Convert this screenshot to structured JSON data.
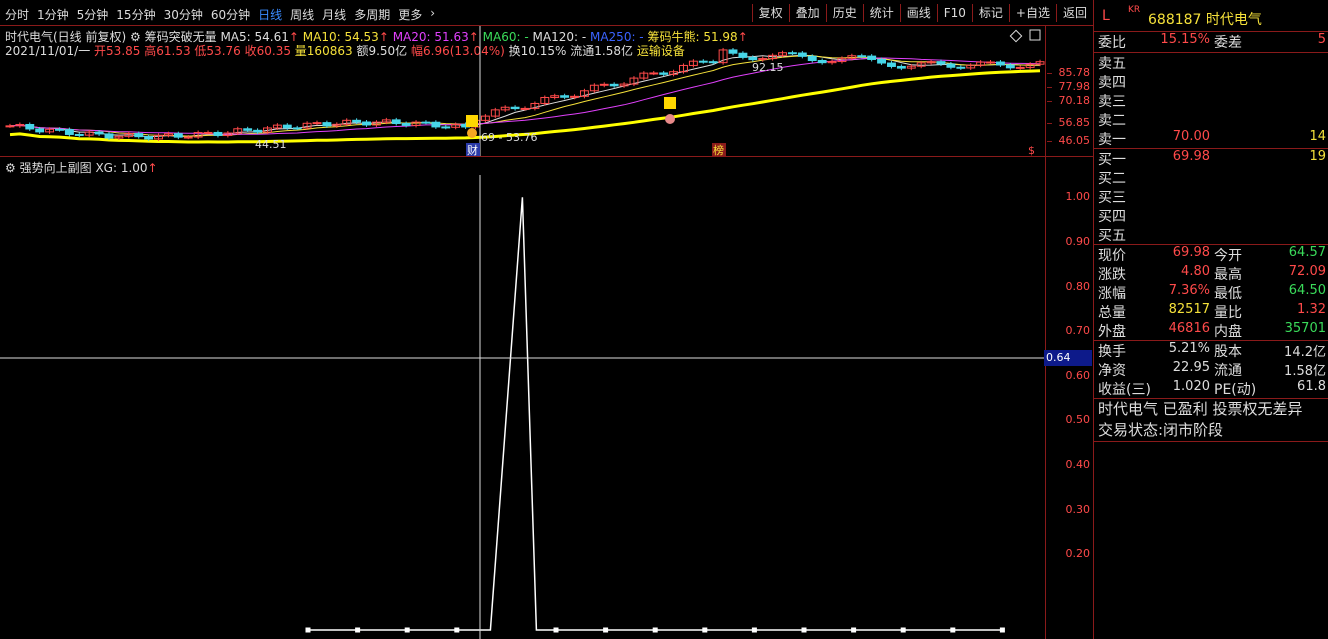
{
  "toolbar": {
    "periods": [
      "分时",
      "1分钟",
      "5分钟",
      "15分钟",
      "30分钟",
      "60分钟",
      "日线",
      "周线",
      "月线",
      "多周期",
      "更多"
    ],
    "active_period": "日线",
    "tools": [
      "复权",
      "叠加",
      "历史",
      "统计",
      "画线",
      "F10",
      "标记",
      "+自选",
      "返回"
    ]
  },
  "info": {
    "stock_title": "时代电气(日线 前复权)",
    "indicator_name": "筹码突破无量",
    "ma5": "MA5: 54.61",
    "ma10": "MA10: 54.53",
    "ma20": "MA20: 51.63",
    "ma60": "MA60: -",
    "ma120": "MA120: -",
    "ma250": "MA250: -",
    "chip_label": "筹码牛熊: 51.98",
    "date": "2021/11/01/一",
    "open": "开53.85",
    "high": "高61.53",
    "low": "低53.76",
    "close": "收60.35",
    "volume": "量160863",
    "amount": "额9.50亿",
    "change": "幅6.96(13.04%)",
    "turnover": "换10.15%",
    "float_shares": "流通1.58亿",
    "industry": "运输设备"
  },
  "main_chart": {
    "ticks": [
      "85.78",
      "77.98",
      "70.18",
      "56.85",
      "46.05"
    ],
    "low_label": "44.51",
    "high_label": "92.15",
    "range_label": "69 - 53.76",
    "marker_cai": "财",
    "marker_bang": "榜",
    "marker_s": "$"
  },
  "sub_chart": {
    "title": "强势向上副图",
    "xg": "XG: 1.00",
    "ticks": [
      "1.00",
      "0.90",
      "0.80",
      "0.70",
      "0.60",
      "0.50",
      "0.40",
      "0.30",
      "0.20"
    ],
    "cursor_value": "0.64",
    "ylim": [
      0.1,
      1.05
    ],
    "xg_values": [
      0,
      0,
      0,
      0,
      1,
      0,
      0,
      0,
      0,
      0,
      0,
      0,
      0,
      0,
      0
    ]
  },
  "chart_data": {
    "type": "line",
    "title": "强势向上副图",
    "series": [
      {
        "name": "XG",
        "values": [
          0,
          0,
          0,
          0,
          1,
          0,
          0,
          0,
          0,
          0,
          0,
          0,
          0,
          0,
          0
        ]
      }
    ],
    "ylim": [
      0.1,
      1.05
    ]
  },
  "panel": {
    "stock_L": "L",
    "stock_kr": "KR",
    "stock_code_name": "688187 时代电气",
    "weibi_label": "委比",
    "weibi": "15.15%",
    "weicha_label": "委差",
    "weicha": "5",
    "sell_levels": [
      {
        "label": "卖五",
        "price": "",
        "vol": ""
      },
      {
        "label": "卖四",
        "price": "",
        "vol": ""
      },
      {
        "label": "卖三",
        "price": "",
        "vol": ""
      },
      {
        "label": "卖二",
        "price": "",
        "vol": ""
      },
      {
        "label": "卖一",
        "price": "70.00",
        "vol": "14"
      }
    ],
    "buy_levels": [
      {
        "label": "买一",
        "price": "69.98",
        "vol": "19"
      },
      {
        "label": "买二",
        "price": "",
        "vol": ""
      },
      {
        "label": "买三",
        "price": "",
        "vol": ""
      },
      {
        "label": "买四",
        "price": "",
        "vol": ""
      },
      {
        "label": "买五",
        "price": "",
        "vol": ""
      }
    ],
    "quote": [
      {
        "l1": "现价",
        "v1": "69.98",
        "c1": "#ff4a4a",
        "l2": "今开",
        "v2": "64.57",
        "c2": "#3adb5a"
      },
      {
        "l1": "涨跌",
        "v1": "4.80",
        "c1": "#ff4a4a",
        "l2": "最高",
        "v2": "72.09",
        "c2": "#ff4a4a"
      },
      {
        "l1": "涨幅",
        "v1": "7.36%",
        "c1": "#ff4a4a",
        "l2": "最低",
        "v2": "64.50",
        "c2": "#3adb5a"
      },
      {
        "l1": "总量",
        "v1": "82517",
        "c1": "#f5e13a",
        "l2": "量比",
        "v2": "1.32",
        "c2": "#ff4a4a"
      },
      {
        "l1": "外盘",
        "v1": "46816",
        "c1": "#ff4a4a",
        "l2": "内盘",
        "v2": "35701",
        "c2": "#3adb5a"
      }
    ],
    "fundamentals": [
      {
        "l1": "换手",
        "v1": "5.21%",
        "l2": "股本",
        "v2": "14.2亿"
      },
      {
        "l1": "净资",
        "v1": "22.95",
        "l2": "流通",
        "v2": "1.58亿"
      },
      {
        "l1": "收益(三)",
        "v1": "1.020",
        "l2": "PE(动)",
        "v2": "61.8"
      }
    ],
    "note1": "时代电气 已盈利 投票权无差异",
    "note2": "交易状态:闭市阶段"
  },
  "colors": {
    "up": "#ff4a4a",
    "down": "#47d6e8",
    "ma5": "#dddddd",
    "ma10": "#f5e13a",
    "ma20": "#e040fb",
    "ma60": "#3adb5a",
    "chip": "#ffff00",
    "grid": "#8a1a1a"
  }
}
